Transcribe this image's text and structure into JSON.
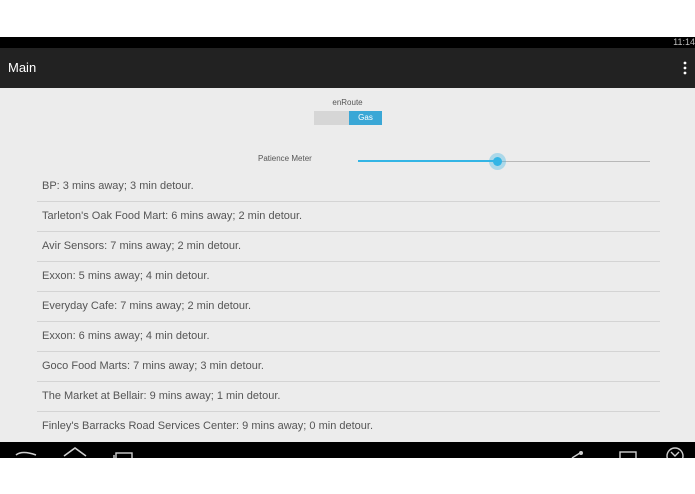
{
  "status_bar": {
    "time": "11:14"
  },
  "action_bar": {
    "title": "Main"
  },
  "toggle": {
    "label": "enRoute",
    "on_text": "Gas"
  },
  "patience": {
    "label": "Patience Meter",
    "level": 0.48
  },
  "stations": [
    "BP: 3 mins away;  3 min detour.",
    "Tarleton's Oak Food Mart: 6 mins away;  2 min detour.",
    "Avir Sensors: 7 mins away;  2 min detour.",
    "Exxon: 5 mins away;  4 min detour.",
    "Everyday Cafe: 7 mins away;  2 min detour.",
    "Exxon: 6 mins away;  4 min detour.",
    "Goco Food Marts: 7 mins away;  3 min detour.",
    "The Market at Bellair: 9 mins away;  1 min detour.",
    "Finley's Barracks Road Services Center: 9 mins away;  0 min detour."
  ],
  "icons": {
    "overflow": "overflow-menu-icon",
    "back": "back-icon",
    "home": "home-icon",
    "recents": "recent-apps-icon",
    "share": "share-icon",
    "screen": "window-icon",
    "close": "close-icon"
  },
  "colors": {
    "accent": "#33b5e5",
    "toggle_on": "#3aa7d6",
    "action_bar": "#222222"
  }
}
